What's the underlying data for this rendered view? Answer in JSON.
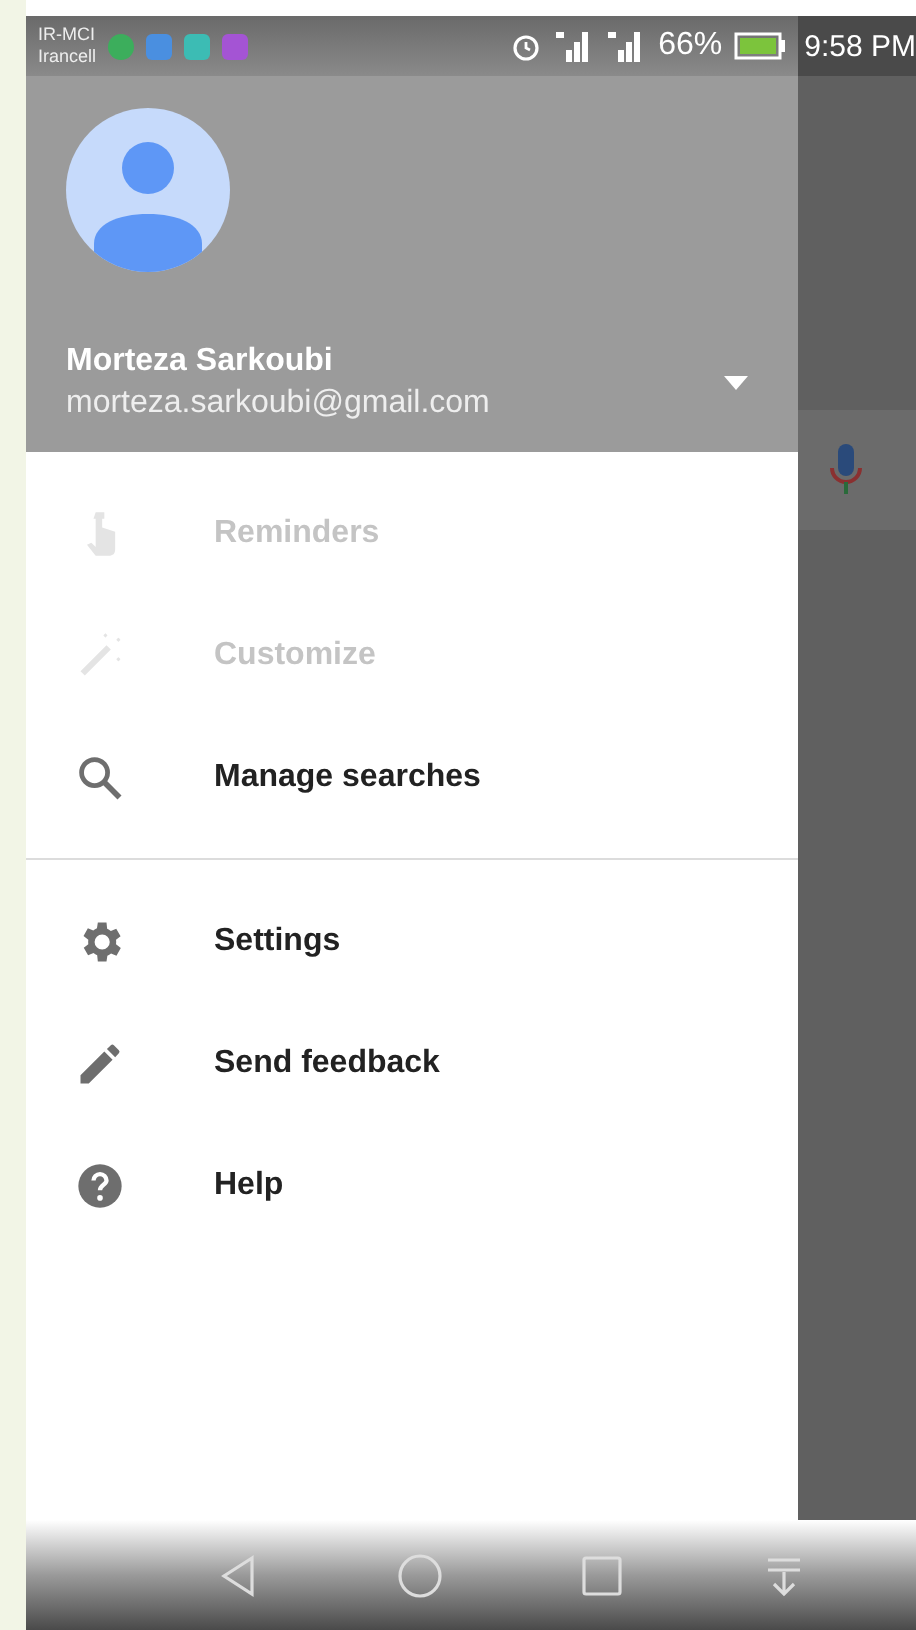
{
  "status_bar": {
    "carrier": [
      "IR-MCI",
      "Irancell"
    ],
    "battery": "66%",
    "time": "9:58 PM"
  },
  "account": {
    "name": "Morteza Sarkoubi",
    "email": "morteza.sarkoubi@gmail.com"
  },
  "menu": {
    "sections": [
      [
        {
          "label": "Reminders",
          "disabled": true
        },
        {
          "label": "Customize",
          "disabled": true
        },
        {
          "label": "Manage searches",
          "disabled": false
        }
      ],
      [
        {
          "label": "Settings",
          "disabled": false
        },
        {
          "label": "Send feedback",
          "disabled": false
        },
        {
          "label": "Help",
          "disabled": false
        }
      ]
    ]
  }
}
